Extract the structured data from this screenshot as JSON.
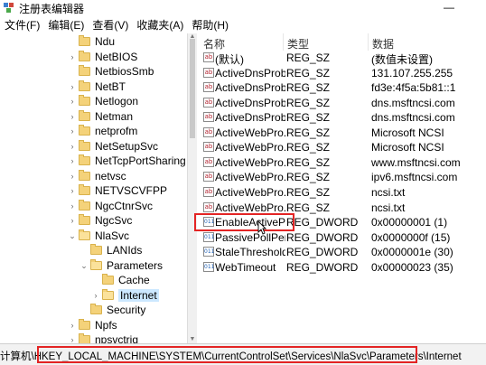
{
  "window": {
    "title": "注册表编辑器",
    "minimize_glyph": "—"
  },
  "menubar": {
    "items": [
      "文件(F)",
      "编辑(E)",
      "查看(V)",
      "收藏夹(A)",
      "帮助(H)"
    ]
  },
  "tree": {
    "items": [
      {
        "label": "Ndu",
        "expander": "none"
      },
      {
        "label": "NetBIOS",
        "expander": "collapsed"
      },
      {
        "label": "NetbiosSmb",
        "expander": "none"
      },
      {
        "label": "NetBT",
        "expander": "collapsed"
      },
      {
        "label": "Netlogon",
        "expander": "collapsed"
      },
      {
        "label": "Netman",
        "expander": "collapsed"
      },
      {
        "label": "netprofm",
        "expander": "collapsed"
      },
      {
        "label": "NetSetupSvc",
        "expander": "collapsed"
      },
      {
        "label": "NetTcpPortSharing",
        "expander": "collapsed"
      },
      {
        "label": "netvsc",
        "expander": "collapsed"
      },
      {
        "label": "NETVSCVFPP",
        "expander": "collapsed"
      },
      {
        "label": "NgcCtnrSvc",
        "expander": "collapsed"
      },
      {
        "label": "NgcSvc",
        "expander": "collapsed"
      },
      {
        "label": "NlaSvc",
        "expander": "expanded"
      },
      {
        "label": "LANIds",
        "expander": "none"
      },
      {
        "label": "Parameters",
        "expander": "expanded"
      },
      {
        "label": "Cache",
        "expander": "none"
      },
      {
        "label": "Internet",
        "expander": "collapsed",
        "selected": true
      },
      {
        "label": "Security",
        "expander": "none"
      },
      {
        "label": "Npfs",
        "expander": "collapsed"
      },
      {
        "label": "npsvctrig",
        "expander": "collapsed"
      }
    ]
  },
  "list": {
    "headers": {
      "name": "名称",
      "type": "类型",
      "data": "数据"
    },
    "rows": [
      {
        "icon": "ab",
        "name": "(默认)",
        "type": "REG_SZ",
        "data": "(数值未设置)"
      },
      {
        "icon": "ab",
        "name": "ActiveDnsProb...",
        "type": "REG_SZ",
        "data": "131.107.255.255"
      },
      {
        "icon": "ab",
        "name": "ActiveDnsProb...",
        "type": "REG_SZ",
        "data": "fd3e:4f5a:5b81::1"
      },
      {
        "icon": "ab",
        "name": "ActiveDnsProb...",
        "type": "REG_SZ",
        "data": "dns.msftncsi.com"
      },
      {
        "icon": "ab",
        "name": "ActiveDnsProb...",
        "type": "REG_SZ",
        "data": "dns.msftncsi.com"
      },
      {
        "icon": "ab",
        "name": "ActiveWebPro...",
        "type": "REG_SZ",
        "data": "Microsoft NCSI"
      },
      {
        "icon": "ab",
        "name": "ActiveWebPro...",
        "type": "REG_SZ",
        "data": "Microsoft NCSI"
      },
      {
        "icon": "ab",
        "name": "ActiveWebPro...",
        "type": "REG_SZ",
        "data": "www.msftncsi.com"
      },
      {
        "icon": "ab",
        "name": "ActiveWebPro...",
        "type": "REG_SZ",
        "data": "ipv6.msftncsi.com"
      },
      {
        "icon": "ab",
        "name": "ActiveWebPro...",
        "type": "REG_SZ",
        "data": "ncsi.txt"
      },
      {
        "icon": "ab",
        "name": "ActiveWebPro...",
        "type": "REG_SZ",
        "data": "ncsi.txt"
      },
      {
        "icon": "dw",
        "name": "EnableActivePr...",
        "type": "REG_DWORD",
        "data": "0x00000001 (1)"
      },
      {
        "icon": "dw",
        "name": "PassivePollPeri...",
        "type": "REG_DWORD",
        "data": "0x0000000f (15)"
      },
      {
        "icon": "dw",
        "name": "StaleThreshold",
        "type": "REG_DWORD",
        "data": "0x0000001e (30)"
      },
      {
        "icon": "dw",
        "name": "WebTimeout",
        "type": "REG_DWORD",
        "data": "0x00000023 (35)"
      }
    ]
  },
  "icon_glyphs": {
    "ab": "ab",
    "dw": "011"
  },
  "statusbar": {
    "path": "计算机\\HKEY_LOCAL_MACHINE\\SYSTEM\\CurrentControlSet\\Services\\NlaSvc\\Parameters\\Internet"
  },
  "colors": {
    "highlight": "#e32424",
    "selection": "#cce8ff"
  }
}
